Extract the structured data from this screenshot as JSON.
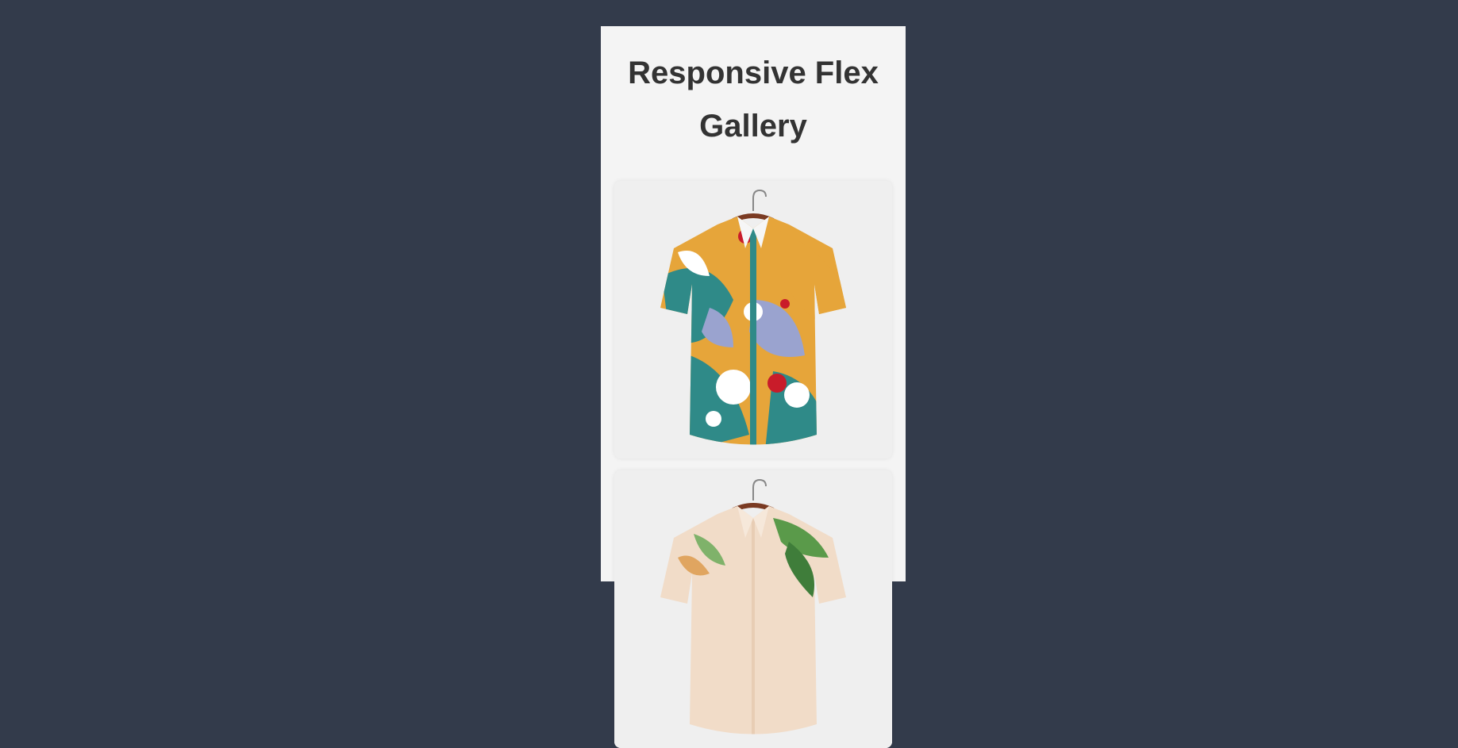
{
  "page": {
    "title": "Responsive Flex Gallery"
  },
  "gallery": {
    "items": [
      {
        "icon": "shirt-abstract-floral-icon",
        "alt": ""
      },
      {
        "icon": "shirt-tropical-leaf-icon",
        "alt": ""
      }
    ]
  },
  "colors": {
    "backdrop": "#333b4b",
    "panel": "#f4f4f4",
    "card": "#ececec",
    "title": "#333333"
  }
}
